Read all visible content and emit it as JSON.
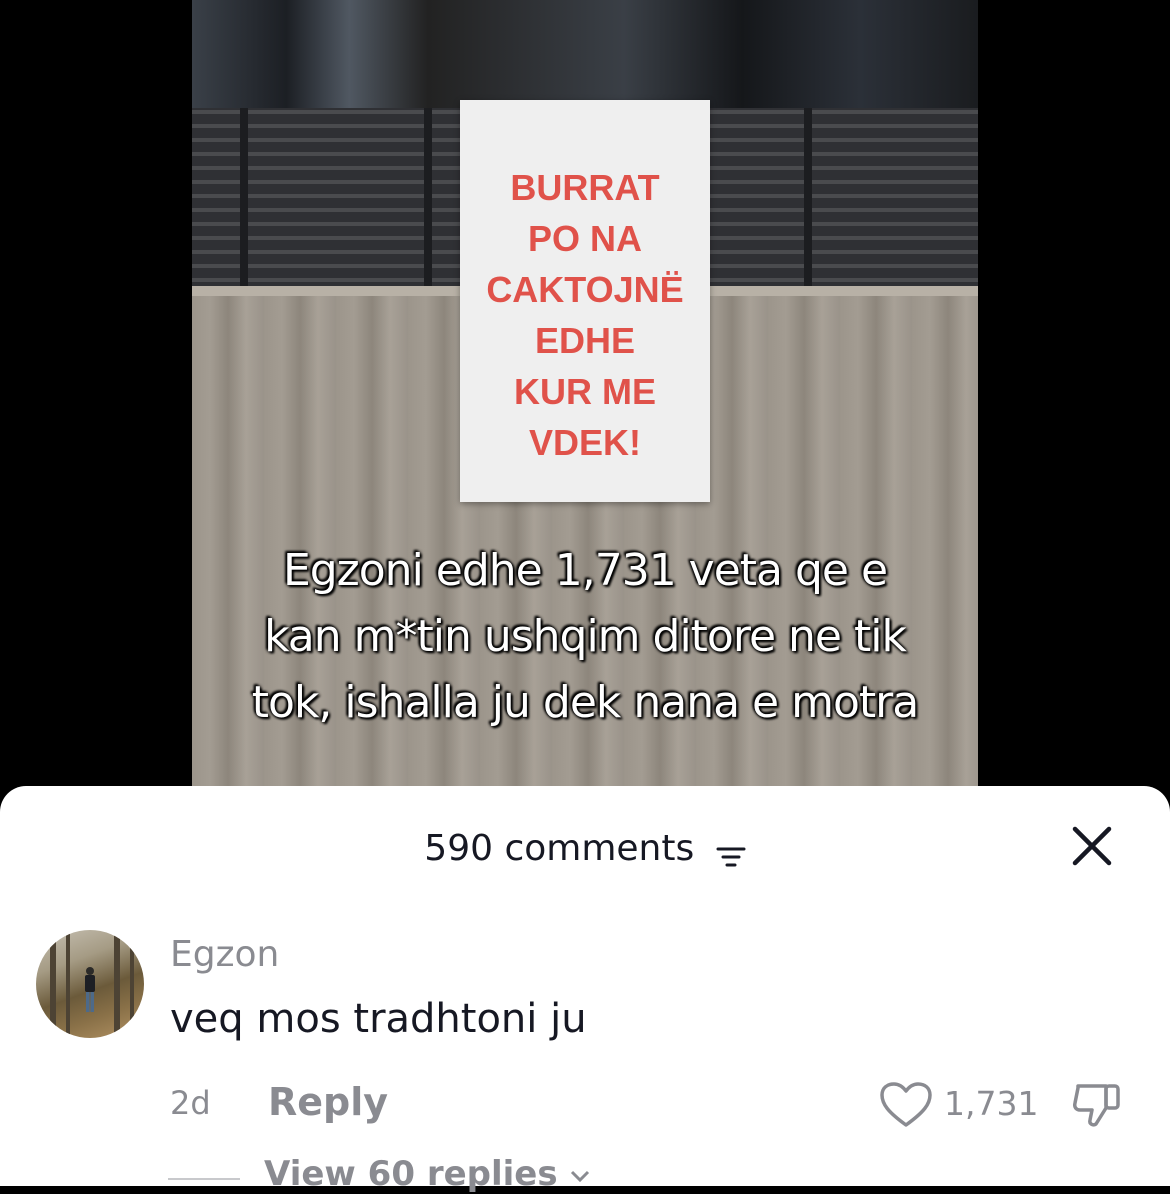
{
  "video": {
    "poster_lines": [
      "BURRAT",
      "PO NA",
      "CAKTOJNË",
      "EDHE",
      "KUR ME",
      "VDEK!"
    ],
    "caption_lines": [
      "Egzoni edhe 1,731 veta qe e",
      "kan m*tin ushqim ditore ne tik",
      "tok, ishalla ju dek nana e motra"
    ]
  },
  "comments_sheet": {
    "title": "590 comments",
    "filter_icon": "filter-icon",
    "close_icon": "close-icon"
  },
  "comment": {
    "username": "Egzon",
    "text": "veq mos tradhtoni ju",
    "time": "2d",
    "reply_label": "Reply",
    "like_count": "1,731",
    "like_icon": "heart-outline-icon",
    "dislike_icon": "thumbs-down-icon",
    "view_replies": "View 60 replies"
  },
  "colors": {
    "poster_text": "#e0524a",
    "muted_text": "#8a8b91",
    "primary_text": "#161823"
  }
}
